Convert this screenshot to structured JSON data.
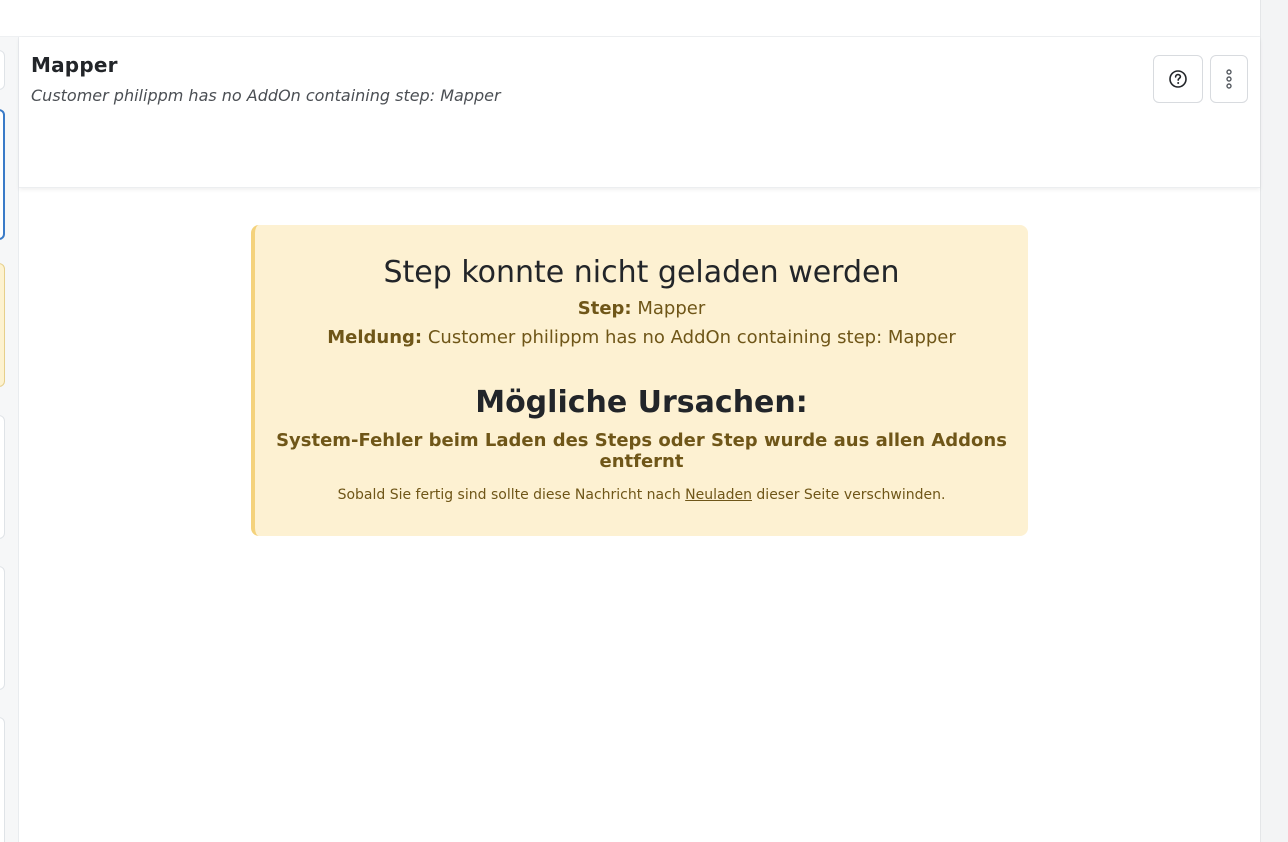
{
  "header": {
    "title": "Mapper",
    "subtitle": "Customer philippm has no AddOn containing step: Mapper",
    "help_icon": "question-circle-icon",
    "more_icon": "vertical-ellipsis-icon"
  },
  "alert": {
    "heading": "Step konnte nicht geladen werden",
    "step_label": "Step:",
    "step_value": "Mapper",
    "message_label": "Meldung:",
    "message_value": "Customer philippm has no AddOn containing step: Mapper",
    "causes_heading": "Mögliche Ursachen:",
    "causes_text": "System-Fehler beim Laden des Steps oder Step wurde aus allen Addons entfernt",
    "note_before": "Sobald Sie fertig sind sollte diese Nachricht nach",
    "note_link": "Neuladen",
    "note_after": "dieser Seite verschwinden."
  },
  "colors": {
    "alert_background": "#fdf1d2",
    "alert_border": "#f4d27c",
    "alert_text": "#6f5618",
    "active_card_border": "#3a7bc8"
  }
}
